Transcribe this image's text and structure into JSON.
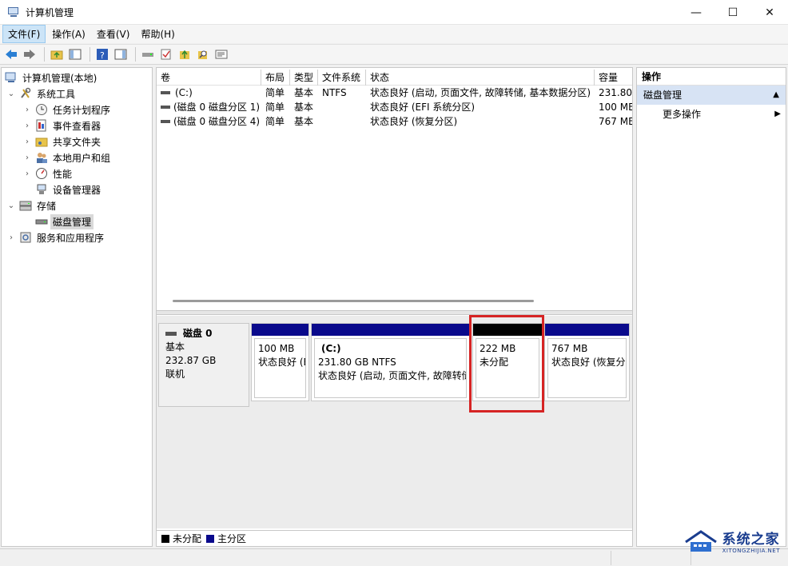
{
  "window": {
    "title": "计算机管理",
    "minimize": "—",
    "maximize": "☐",
    "close": "✕"
  },
  "menu": [
    "文件(F)",
    "操作(A)",
    "查看(V)",
    "帮助(H)"
  ],
  "tree": {
    "root": "计算机管理(本地)",
    "system_tools": "系统工具",
    "task_scheduler": "任务计划程序",
    "event_viewer": "事件查看器",
    "shared_folders": "共享文件夹",
    "local_users": "本地用户和组",
    "performance": "性能",
    "device_manager": "设备管理器",
    "storage": "存储",
    "disk_management": "磁盘管理",
    "services": "服务和应用程序"
  },
  "volumes": {
    "columns": [
      "卷",
      "布局",
      "类型",
      "文件系统",
      "状态",
      "容量"
    ],
    "rows": [
      {
        "name": "(C:)",
        "layout": "简单",
        "type": "基本",
        "fs": "NTFS",
        "status": "状态良好 (启动, 页面文件, 故障转储, 基本数据分区)",
        "capacity": "231.80"
      },
      {
        "name": "(磁盘 0 磁盘分区 1)",
        "layout": "简单",
        "type": "基本",
        "fs": "",
        "status": "状态良好 (EFI 系统分区)",
        "capacity": "100 ME"
      },
      {
        "name": "(磁盘 0 磁盘分区 4)",
        "layout": "简单",
        "type": "基本",
        "fs": "",
        "status": "状态良好 (恢复分区)",
        "capacity": "767 ME"
      }
    ]
  },
  "disk": {
    "name": "磁盘 0",
    "type": "基本",
    "size": "232.87 GB",
    "state": "联机",
    "partitions": [
      {
        "title": "",
        "size": "100 MB",
        "status": "状态良好 (E",
        "kind": "primary"
      },
      {
        "title": "(C:)",
        "size": "231.80 GB NTFS",
        "status": "状态良好 (启动, 页面文件, 故障转储",
        "kind": "primary"
      },
      {
        "title": "",
        "size": "222 MB",
        "status": "未分配",
        "kind": "unallocated"
      },
      {
        "title": "",
        "size": "767 MB",
        "status": "状态良好 (恢复分",
        "kind": "primary"
      }
    ]
  },
  "legend": {
    "unallocated": "未分配",
    "primary": "主分区"
  },
  "colors": {
    "primary": "#0a0a8c",
    "unallocated": "#000000",
    "highlight": "#d62424",
    "action_section": "#d7e3f4"
  },
  "actions": {
    "header": "操作",
    "section": "磁盘管理",
    "more": "更多操作"
  },
  "watermark": {
    "brand": "系统之家",
    "url": "XITONGZHIJIA.NET"
  }
}
